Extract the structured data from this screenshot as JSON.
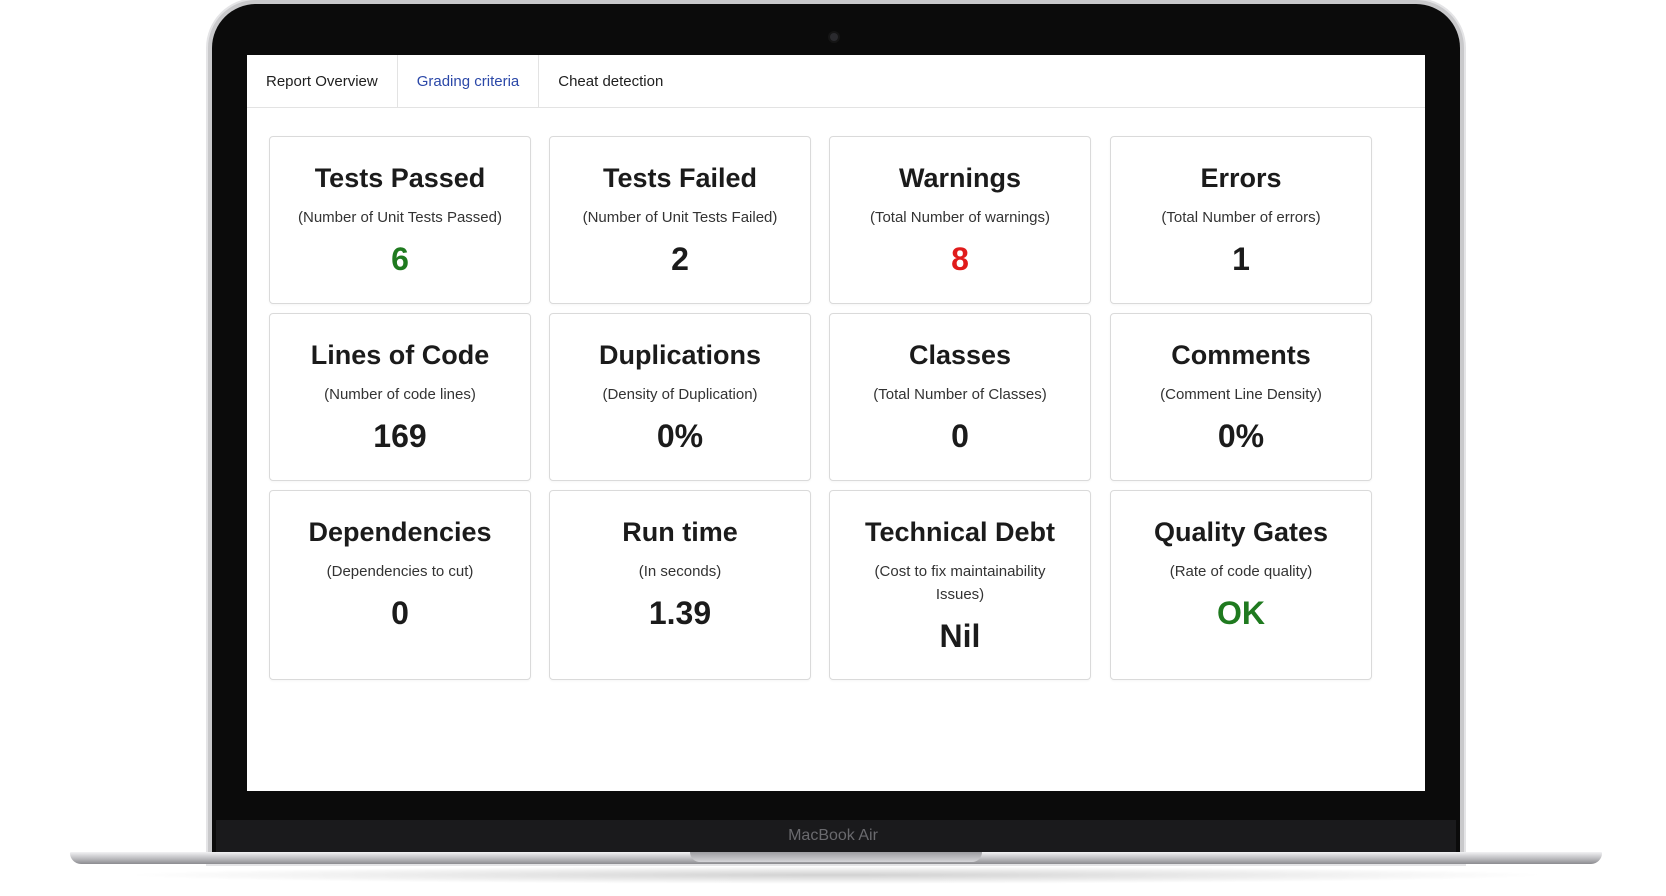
{
  "device": {
    "brand": "MacBook Air"
  },
  "tabs": [
    {
      "label": "Report Overview",
      "active": false
    },
    {
      "label": "Grading criteria",
      "active": true
    },
    {
      "label": "Cheat detection",
      "active": false
    }
  ],
  "colors": {
    "green": "#1f7a1f",
    "red": "#e01b1b",
    "dark": "#1b1b1b",
    "tab_active": "#2b48a8"
  },
  "cards": [
    {
      "title": "Tests Passed",
      "subtitle": "(Number of Unit Tests Passed)",
      "value": "6",
      "value_color": "#1f7a1f"
    },
    {
      "title": "Tests Failed",
      "subtitle": "(Number of Unit Tests Failed)",
      "value": "2",
      "value_color": "#1b1b1b"
    },
    {
      "title": "Warnings",
      "subtitle": "(Total Number of warnings)",
      "value": "8",
      "value_color": "#e01b1b"
    },
    {
      "title": "Errors",
      "subtitle": "(Total Number of errors)",
      "value": "1",
      "value_color": "#1b1b1b"
    },
    {
      "title": "Lines of Code",
      "subtitle": "(Number of code lines)",
      "value": "169",
      "value_color": "#1b1b1b"
    },
    {
      "title": "Duplications",
      "subtitle": "(Density of Duplication)",
      "value": "0%",
      "value_color": "#1b1b1b"
    },
    {
      "title": "Classes",
      "subtitle": "(Total Number of Classes)",
      "value": "0",
      "value_color": "#1b1b1b"
    },
    {
      "title": "Comments",
      "subtitle": "(Comment Line Density)",
      "value": "0%",
      "value_color": "#1b1b1b"
    },
    {
      "title": "Dependencies",
      "subtitle": "(Dependencies to cut)",
      "value": "0",
      "value_color": "#1b1b1b"
    },
    {
      "title": "Run time",
      "subtitle": "(In seconds)",
      "value": "1.39",
      "value_color": "#1b1b1b"
    },
    {
      "title": "Technical Debt",
      "subtitle": "(Cost to fix maintainability Issues)",
      "value": "Nil",
      "value_color": "#1b1b1b"
    },
    {
      "title": "Quality Gates",
      "subtitle": "(Rate of code quality)",
      "value": "OK",
      "value_color": "#1f7a1f"
    }
  ]
}
